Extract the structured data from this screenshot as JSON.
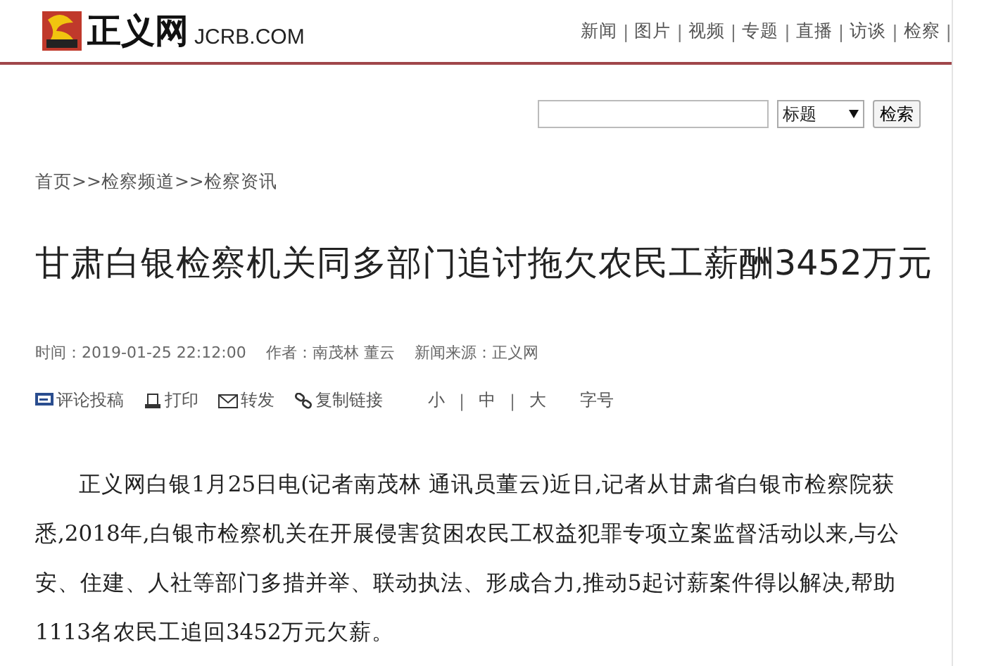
{
  "logo": {
    "name": "正义网",
    "domain": "JCRB.COM"
  },
  "nav": {
    "separator": "|",
    "items": [
      "新闻",
      "图片",
      "视频",
      "专题",
      "直播",
      "访谈",
      "检察"
    ],
    "trailing_separator": "|"
  },
  "search": {
    "category": "标题",
    "button": "检索"
  },
  "breadcrumb": {
    "separator": ">>",
    "items": [
      "首页",
      "检察频道",
      "检察资讯"
    ]
  },
  "article": {
    "title": "甘肃白银检察机关同多部门追讨拖欠农民工薪酬3452万元",
    "meta": [
      "时间：2019-01-25 22:12:00",
      "作者：南茂林 董云",
      "新闻来源：正义网"
    ],
    "tools": [
      {
        "kind": "comment",
        "label": "评论投稿"
      },
      {
        "kind": "print",
        "label": "打印"
      },
      {
        "kind": "mail",
        "label": "转发"
      },
      {
        "kind": "link",
        "label": "复制链接"
      }
    ],
    "font_sizes": [
      "小",
      "中",
      "大"
    ],
    "font_size_separator": "|",
    "font_size_label": "字号",
    "body": "正义网白银1月25日电(记者南茂林 通讯员董云)近日,记者从甘肃省白银市检察院获悉,2018年,白银市检察机关在开展侵害贫困农民工权益犯罪专项立案监督活动以来,与公安、住建、人社等部门多措并举、联动执法、形成合力,推动5起讨薪案件得以解决,帮助1113名农民工追回3452万元欠薪。"
  }
}
